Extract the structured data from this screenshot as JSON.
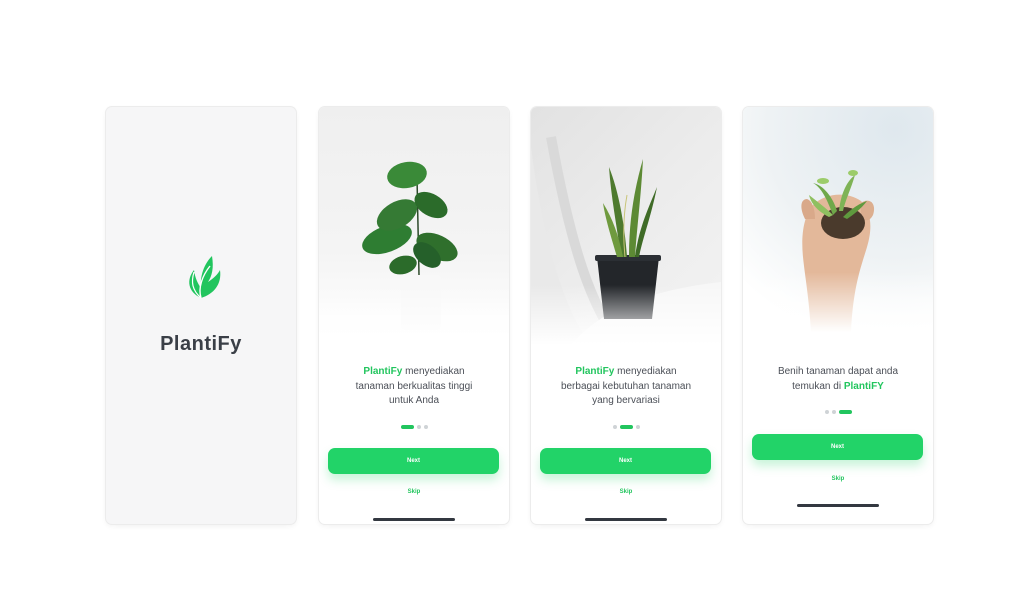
{
  "brand": {
    "name": "PlantiFy",
    "color": "#22c55e"
  },
  "screens": [
    {
      "id": "splash",
      "app_name": "PlantiFy"
    },
    {
      "id": "onboarding-1",
      "image": "fiddle-leaf-fig-plant",
      "copy_brand": "PlantiFy",
      "copy_rest_line1": " menyediakan",
      "copy_line2": "tanaman berkualitas tinggi",
      "copy_line3": "untuk Anda",
      "page_index": 0,
      "next_label": "Next",
      "skip_label": "Skip"
    },
    {
      "id": "onboarding-2",
      "image": "snake-plant-in-pot",
      "copy_brand": "PlantiFy",
      "copy_rest_line1": " menyediakan",
      "copy_line2": "berbagai kebutuhan tanaman",
      "copy_line3": "yang bervariasi",
      "page_index": 1,
      "next_label": "Next",
      "skip_label": "Skip"
    },
    {
      "id": "onboarding-3",
      "image": "hand-holding-seedling",
      "copy_line1": "Benih tanaman dapat anda",
      "copy_line2_prefix": "temukan di ",
      "copy_brand": "PlantiFY",
      "page_index": 2,
      "next_label": "Next",
      "skip_label": "Skip"
    }
  ],
  "colors": {
    "accent": "#22d368",
    "text": "#4b4f57",
    "dot_inactive": "#cfd3d6"
  }
}
